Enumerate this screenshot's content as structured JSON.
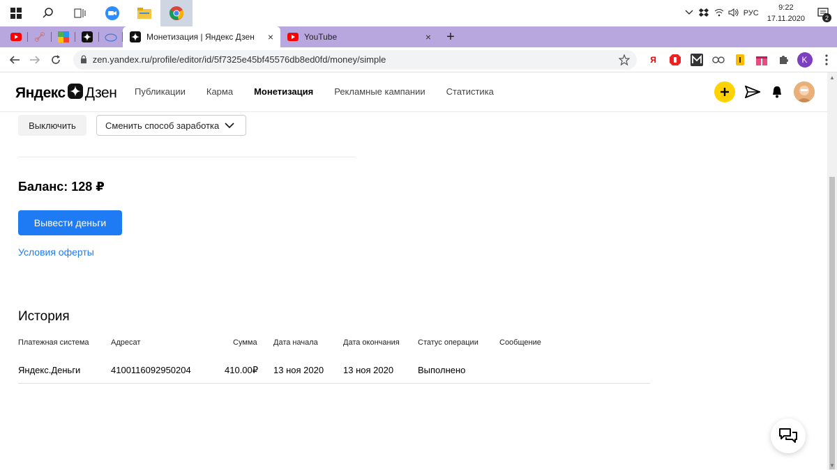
{
  "taskbar": {
    "lang": "РУС",
    "time": "9:22",
    "date": "17.11.2020",
    "notif_count": "2"
  },
  "tabs": {
    "active_title": "Монетизация | Яндекс Дзен",
    "second_title": "YouTube",
    "close": "×",
    "new": "+"
  },
  "window": {
    "min": "—",
    "max": "❐",
    "close": "✕"
  },
  "address": {
    "url": "zen.yandex.ru/profile/editor/id/5f7325e45bf45576db8ed0fd/money/simple",
    "ext_ya": "Я",
    "ext_k": "K"
  },
  "site": {
    "logo_left": "Яндекс",
    "logo_right": "Дзен",
    "menu": [
      "Публикации",
      "Карма",
      "Монетизация",
      "Рекламные кампании",
      "Статистика"
    ],
    "active_menu": "Монетизация"
  },
  "controls": {
    "disable_button": "Выключить",
    "change_method": "Сменить способ заработка"
  },
  "balance": {
    "label": "Баланс: 128 ₽",
    "withdraw_button": "Вывести деньги",
    "offer_link": "Условия оферты"
  },
  "history": {
    "title": "История",
    "columns": [
      "Платежная система",
      "Адресат",
      "Сумма",
      "Дата начала",
      "Дата окончания",
      "Статус операции",
      "Сообщение"
    ],
    "rows": [
      [
        "Яндекс.Деньги",
        "4100116092950204",
        "410.00₽",
        "13 ноя 2020",
        "13 ноя 2020",
        "Выполнено",
        ""
      ]
    ]
  },
  "colors": {
    "accent_blue": "#1f7bf4",
    "zen_yellow": "#ffd302",
    "tabstrip": "#b8a7de"
  }
}
